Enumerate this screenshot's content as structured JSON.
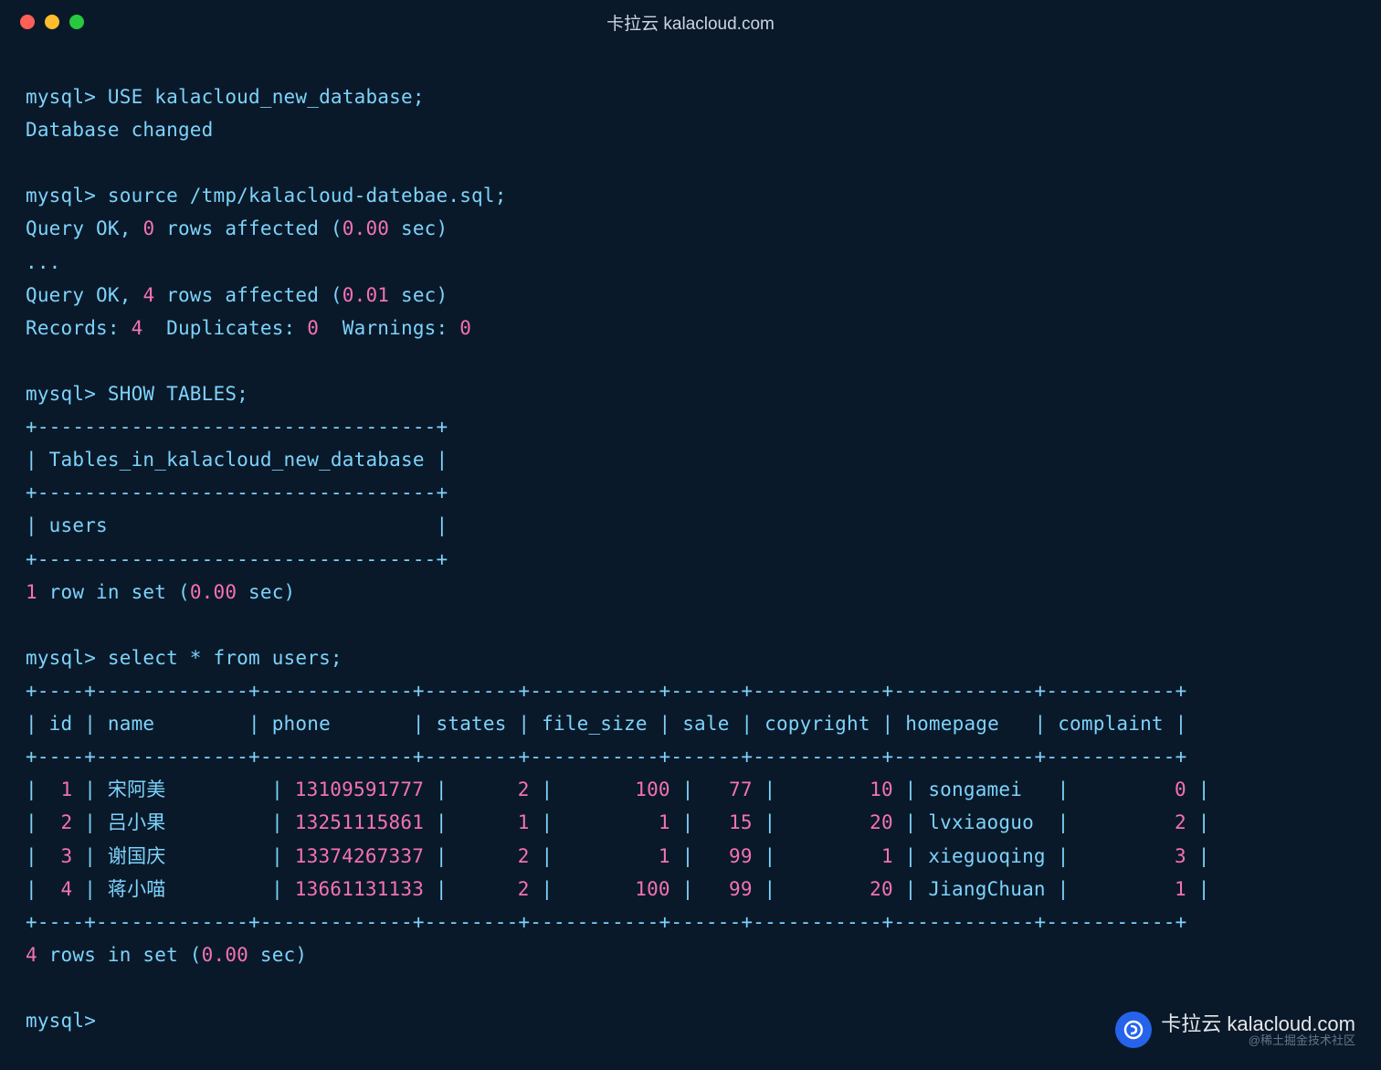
{
  "window": {
    "title": "卡拉云 kalacloud.com"
  },
  "session": {
    "prompt": "mysql>",
    "cmd_use": "USE kalacloud_new_database;",
    "resp_use": "Database changed",
    "cmd_source": "source /tmp/kalacloud-datebae.sql;",
    "resp_source_1a": "Query OK, ",
    "resp_source_1b": "0",
    "resp_source_1c": " rows affected (",
    "resp_source_1d": "0.00",
    "resp_source_1e": " sec)",
    "ellipsis": "...",
    "resp_source_2a": "Query OK, ",
    "resp_source_2b": "4",
    "resp_source_2c": " rows affected (",
    "resp_source_2d": "0.01",
    "resp_source_2e": " sec)",
    "resp_source_3a": "Records: ",
    "resp_source_3b": "4",
    "resp_source_3c": "  Duplicates: ",
    "resp_source_3d": "0",
    "resp_source_3e": "  Warnings: ",
    "resp_source_3f": "0",
    "cmd_show": "SHOW TABLES;",
    "tbl1_border": "+----------------------------------+",
    "tbl1_header": "| Tables_in_kalacloud_new_database |",
    "tbl1_row": "| users                            |",
    "tbl1_count_a": "1",
    "tbl1_count_b": " row in set (",
    "tbl1_count_c": "0.00",
    "tbl1_count_d": " sec)",
    "cmd_select": "select * from users;",
    "tbl2_border": "+----+-------------+-------------+--------+-----------+------+-----------+------------+-----------+",
    "tbl2_header": "| id | name        | phone       | states | file_size | sale | copyright | homepage   | complaint |",
    "tbl2_rows": [
      {
        "id": "1",
        "name": "宋阿美",
        "phone": "13109591777",
        "states": "2",
        "file_size": "100",
        "sale": "77",
        "copyright": "10",
        "homepage": "songamei  ",
        "complaint": "0"
      },
      {
        "id": "2",
        "name": "吕小果",
        "phone": "13251115861",
        "states": "1",
        "file_size": "1",
        "sale": "15",
        "copyright": "20",
        "homepage": "lvxiaoguo ",
        "complaint": "2"
      },
      {
        "id": "3",
        "name": "谢国庆",
        "phone": "13374267337",
        "states": "2",
        "file_size": "1",
        "sale": "99",
        "copyright": "1",
        "homepage": "xieguoqing",
        "complaint": "3"
      },
      {
        "id": "4",
        "name": "蒋小喵",
        "phone": "13661131133",
        "states": "2",
        "file_size": "100",
        "sale": "99",
        "copyright": "20",
        "homepage": "JiangChuan",
        "complaint": "1"
      }
    ],
    "tbl2_count_a": "4",
    "tbl2_count_b": " rows in set (",
    "tbl2_count_c": "0.00",
    "tbl2_count_d": " sec)"
  },
  "watermark": {
    "main": "卡拉云 kalacloud.com",
    "sub": "@稀土掘金技术社区"
  }
}
